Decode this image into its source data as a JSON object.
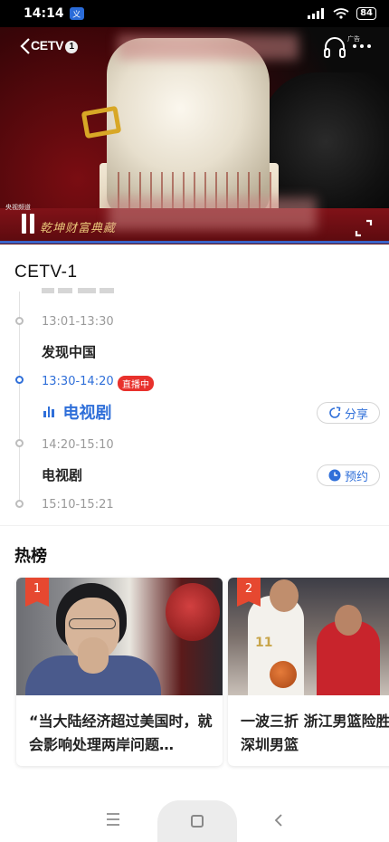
{
  "status_bar": {
    "time": "14:14",
    "app_badge": "义",
    "network": "HD",
    "battery": "84"
  },
  "player": {
    "channel_logo": "CETV",
    "channel_logo_number": "1",
    "ad_mark": "广告",
    "ticker_text": "乾坤财富典藏",
    "ticker_small": "央视频道"
  },
  "program": {
    "channel_title": "CETV-1",
    "items": [
      {
        "time": "13:01-13:30",
        "title": "发现中国"
      },
      {
        "time": "13:30-14:20",
        "badge": "直播中",
        "title": "电视剧",
        "action": "分享"
      },
      {
        "time": "14:20-15:10",
        "title": "电视剧",
        "action": "预约"
      },
      {
        "time": "15:10-15:21"
      }
    ]
  },
  "hot": {
    "title": "热榜",
    "cards": [
      {
        "rank": "1",
        "text": "“当大陆经济超过美国时，就会影响处理两岸问题…"
      },
      {
        "rank": "2",
        "text": "一波三折 浙江男篮险胜深圳男篮",
        "jersey": "11"
      }
    ]
  },
  "colors": {
    "accent": "#2f6fd9",
    "live_badge": "#e8312c",
    "rank_flag": "#e64830"
  }
}
